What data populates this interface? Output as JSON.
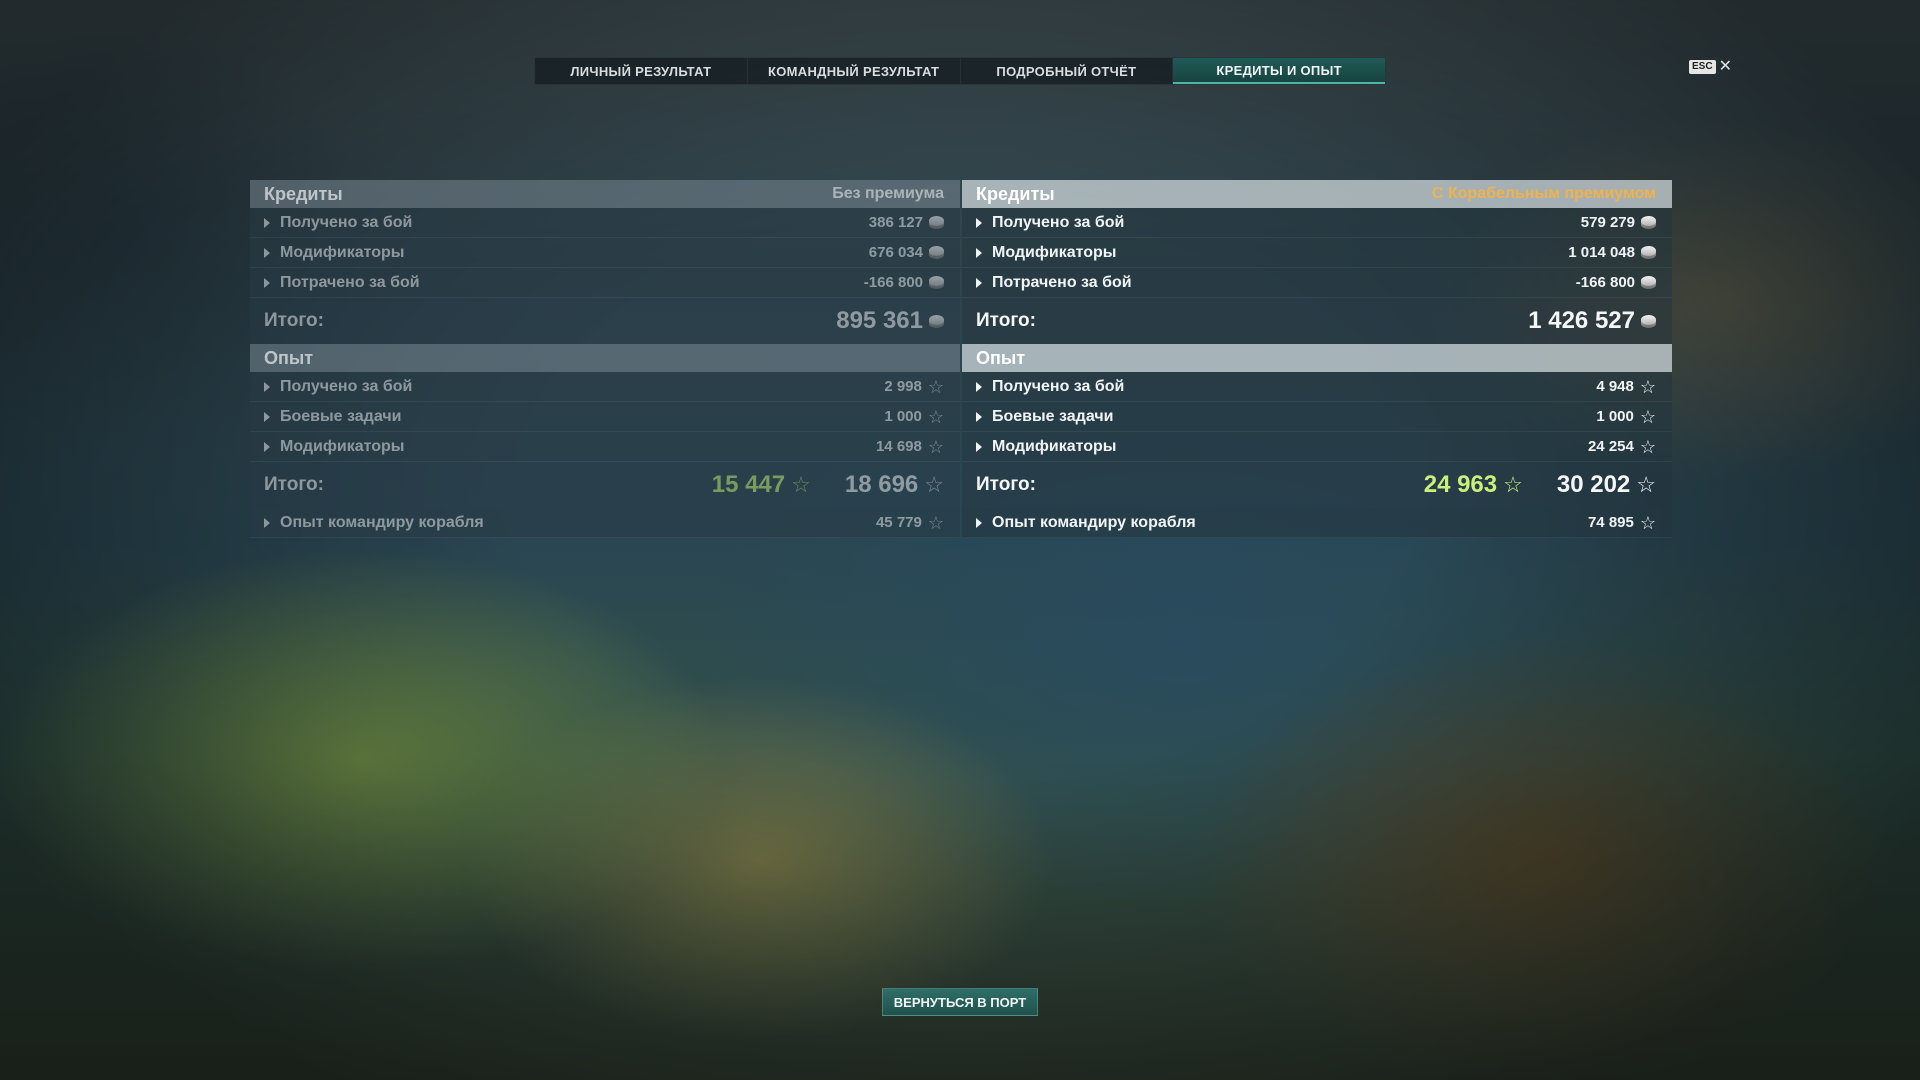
{
  "tabs": [
    {
      "label": "ЛИЧНЫЙ РЕЗУЛЬТАТ",
      "active": false
    },
    {
      "label": "КОМАНДНЫЙ РЕЗУЛЬТАТ",
      "active": false
    },
    {
      "label": "ПОДРОБНЫЙ ОТЧЁТ",
      "active": false
    },
    {
      "label": "КРЕДИТЫ И ОПЫТ",
      "active": true
    }
  ],
  "esc": {
    "key": "ESC",
    "close": "✕"
  },
  "icons": {
    "credits": "credit-coin-icon",
    "xp": "star-icon",
    "expand": "chevron-right-icon"
  },
  "colors": {
    "premium_label": "#f0b24a",
    "xp_green": "#c9f07a",
    "active_tab": "#1f5a56"
  },
  "left": {
    "credits": {
      "title": "Кредиты",
      "subtitle": "Без премиума",
      "rows": [
        {
          "label": "Получено за бой",
          "value": "386 127"
        },
        {
          "label": "Модификаторы",
          "value": "676 034"
        },
        {
          "label": "Потрачено за бой",
          "value": "-166 800"
        }
      ],
      "total_label": "Итого:",
      "total": "895 361"
    },
    "xp": {
      "title": "Опыт",
      "rows": [
        {
          "label": "Получено за бой",
          "value": "2 998"
        },
        {
          "label": "Боевые задачи",
          "value": "1 000"
        },
        {
          "label": "Модификаторы",
          "value": "14 698"
        }
      ],
      "total_label": "Итого:",
      "total_free": "15 447",
      "total": "18 696",
      "commander_label": "Опыт командиру корабля",
      "commander_value": "45 779"
    }
  },
  "right": {
    "credits": {
      "title": "Кредиты",
      "subtitle": "С Корабельным премиумом",
      "rows": [
        {
          "label": "Получено за бой",
          "value": "579 279"
        },
        {
          "label": "Модификаторы",
          "value": "1 014 048"
        },
        {
          "label": "Потрачено за бой",
          "value": "-166 800"
        }
      ],
      "total_label": "Итого:",
      "total": "1 426 527"
    },
    "xp": {
      "title": "Опыт",
      "rows": [
        {
          "label": "Получено за бой",
          "value": "4 948"
        },
        {
          "label": "Боевые задачи",
          "value": "1 000"
        },
        {
          "label": "Модификаторы",
          "value": "24 254"
        }
      ],
      "total_label": "Итого:",
      "total_free": "24 963",
      "total": "30 202",
      "commander_label": "Опыт командиру корабля",
      "commander_value": "74 895"
    }
  },
  "back_button": "ВЕРНУТЬСЯ В ПОРТ"
}
